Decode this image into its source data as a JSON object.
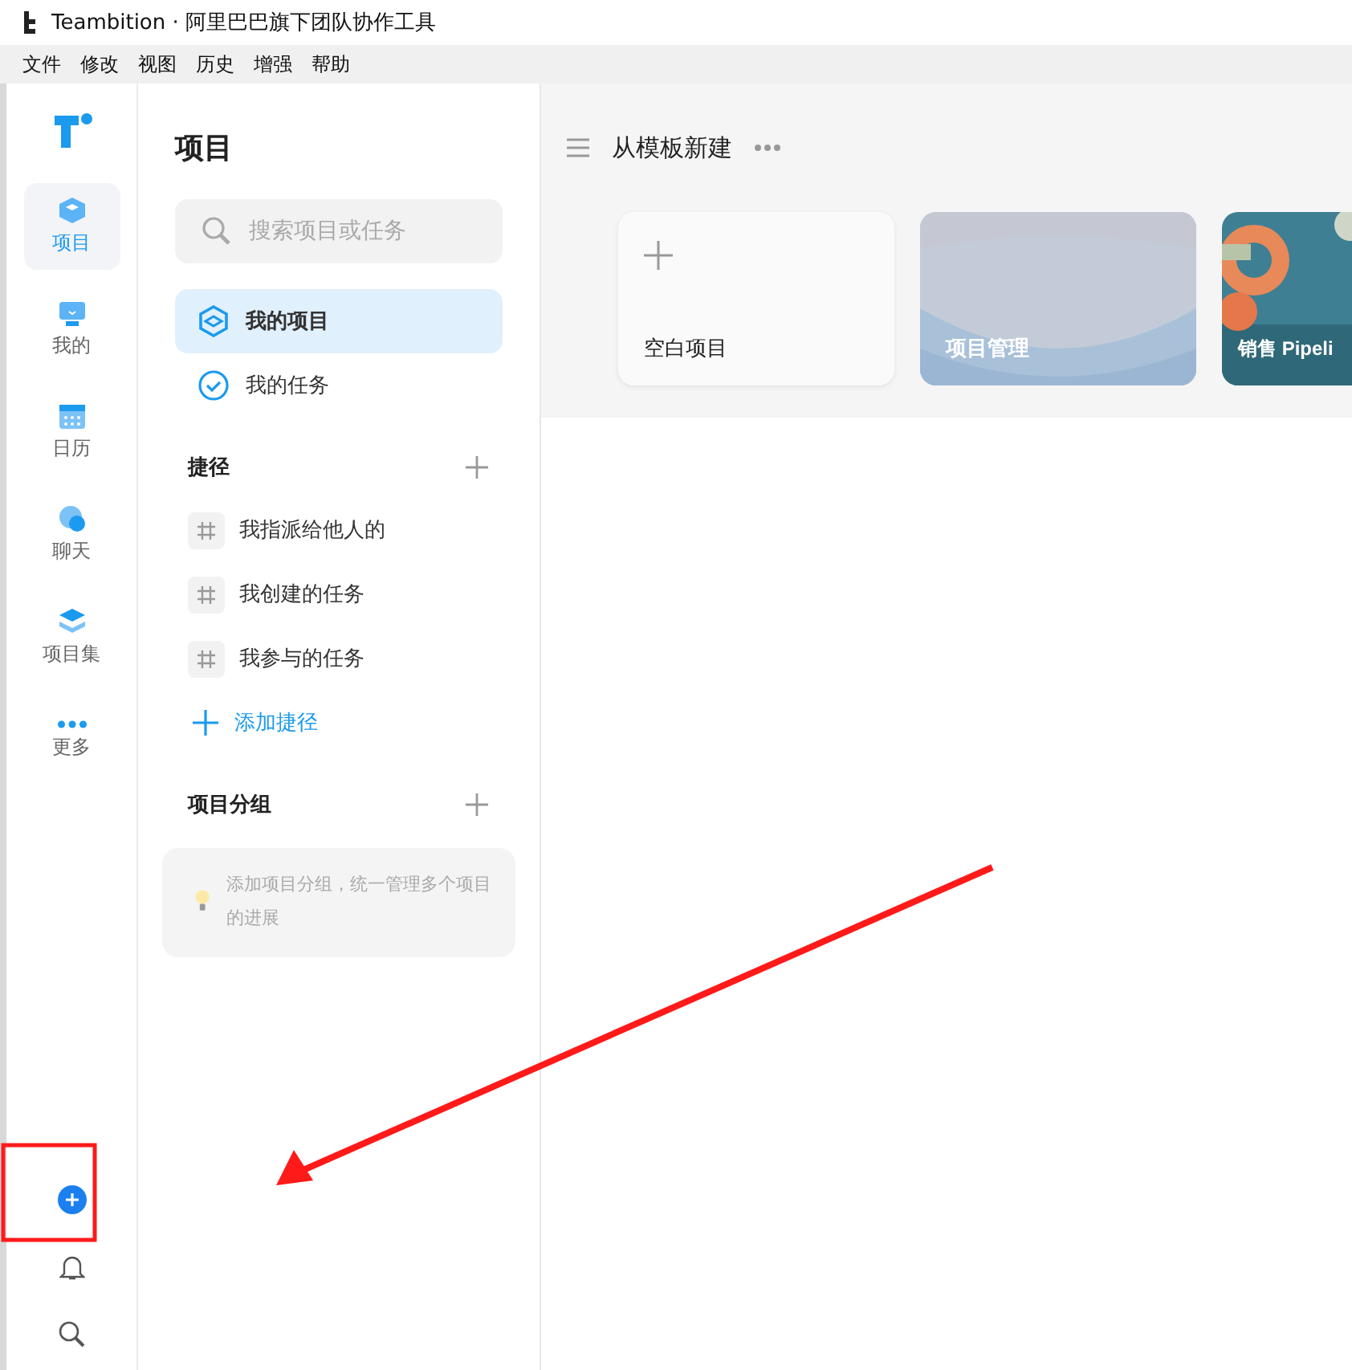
{
  "window": {
    "title": "Teambition · 阿里巴巴旗下团队协作工具"
  },
  "menu": [
    "文件",
    "修改",
    "视图",
    "历史",
    "增强",
    "帮助"
  ],
  "rail": {
    "items": [
      {
        "kind": "project",
        "label": "项目",
        "selected": true
      },
      {
        "kind": "mine",
        "label": "我的",
        "selected": false
      },
      {
        "kind": "calendar",
        "label": "日历",
        "selected": false
      },
      {
        "kind": "chat",
        "label": "聊天",
        "selected": false
      },
      {
        "kind": "collection",
        "label": "项目集",
        "selected": false
      },
      {
        "kind": "more",
        "label": "更多",
        "selected": false
      }
    ]
  },
  "panel": {
    "title": "项目",
    "search": {
      "placeholder": "搜索项目或任务"
    },
    "nav": [
      {
        "kind": "projects",
        "label": "我的项目",
        "selected": true
      },
      {
        "kind": "tasks",
        "label": "我的任务",
        "selected": false
      }
    ],
    "shortcuts": {
      "title": "捷径",
      "items": [
        "我指派给他人的",
        "我创建的任务",
        "我参与的任务"
      ],
      "add_label": "添加捷径"
    },
    "groups": {
      "title": "项目分组",
      "hint": "添加项目分组，统一管理多个项目的进展"
    }
  },
  "templates": {
    "title": "从模板新建",
    "cards": [
      {
        "kind": "blank",
        "label": "空白项目"
      },
      {
        "kind": "picture",
        "label": "项目管理"
      },
      {
        "kind": "picture",
        "label": "销售 Pipeli"
      }
    ]
  }
}
